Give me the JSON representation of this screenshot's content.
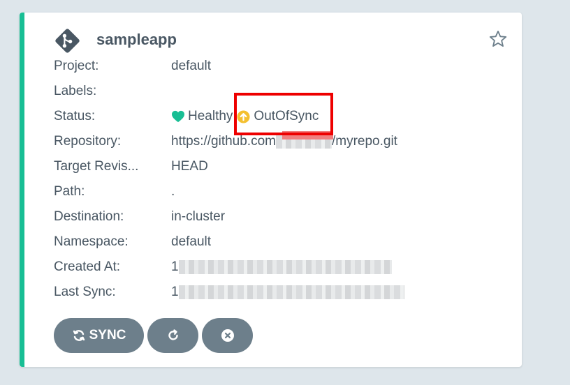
{
  "app": {
    "name": "sampleapp",
    "accent_color": "#18be94",
    "icon": "git-icon"
  },
  "fields": [
    {
      "label": "Project:",
      "value": "default"
    },
    {
      "label": "Labels:",
      "value": ""
    },
    {
      "label": "Status:",
      "health": "Healthy",
      "sync": "OutOfSync"
    },
    {
      "label": "Repository:",
      "value_prefix": "https://github.com",
      "value_suffix": "/myrepo.git"
    },
    {
      "label": "Target Revis...",
      "value": "HEAD"
    },
    {
      "label": "Path:",
      "value": "."
    },
    {
      "label": "Destination:",
      "value": "in-cluster"
    },
    {
      "label": "Namespace:",
      "value": "default"
    },
    {
      "label": "Created At:",
      "value_prefix": "1"
    },
    {
      "label": "Last Sync:",
      "value_prefix": "1"
    }
  ],
  "status_colors": {
    "healthy": "#18be94",
    "out_of_sync": "#f4c030"
  },
  "buttons": {
    "sync_label": "SYNC",
    "sync_icon": "sync-icon",
    "refresh_icon": "refresh-icon",
    "delete_icon": "close-circle-icon"
  },
  "favorite_icon": "star-icon"
}
